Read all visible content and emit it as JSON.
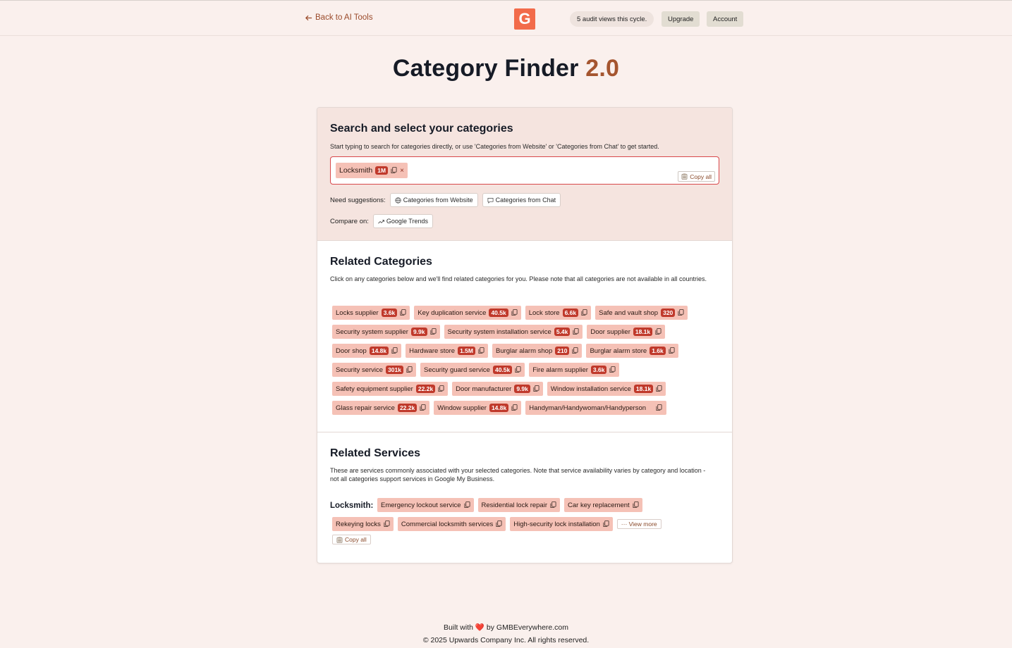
{
  "header": {
    "back_label": "Back to AI Tools",
    "logo_letter": "G",
    "audit_text": "5 audit views this cycle.",
    "upgrade_label": "Upgrade",
    "account_label": "Account"
  },
  "page": {
    "title_main": "Category Finder",
    "title_version": "2.0"
  },
  "search": {
    "heading": "Search and select your categories",
    "description": "Start typing to search for categories directly, or use 'Categories from Website' or 'Categories from Chat' to get started.",
    "selected": [
      {
        "label": "Locksmith",
        "count": "1M"
      }
    ],
    "copy_all_label": "Copy all",
    "suggestions_label": "Need suggestions:",
    "from_website_label": "Categories from Website",
    "from_chat_label": "Categories from Chat",
    "compare_label": "Compare on:",
    "google_trends_label": "Google Trends"
  },
  "related": {
    "heading": "Related Categories",
    "description": "Click on any categories below and we'll find related categories for you. Please note that all categories are not available in all countries.",
    "items": [
      {
        "label": "Locks supplier",
        "count": "3.6k"
      },
      {
        "label": "Key duplication service",
        "count": "40.5k"
      },
      {
        "label": "Lock store",
        "count": "6.6k"
      },
      {
        "label": "Safe and vault shop",
        "count": "320"
      },
      {
        "label": "Security system supplier",
        "count": "9.9k"
      },
      {
        "label": "Security system installation service",
        "count": "5.4k"
      },
      {
        "label": "Door supplier",
        "count": "18.1k"
      },
      {
        "label": "Door shop",
        "count": "14.8k"
      },
      {
        "label": "Hardware store",
        "count": "1.5M"
      },
      {
        "label": "Burglar alarm shop",
        "count": "210"
      },
      {
        "label": "Burglar alarm store",
        "count": "1.6k"
      },
      {
        "label": "Security service",
        "count": "301k"
      },
      {
        "label": "Security guard service",
        "count": "40.5k"
      },
      {
        "label": "Fire alarm supplier",
        "count": "3.6k"
      },
      {
        "label": "Safety equipment supplier",
        "count": "22.2k"
      },
      {
        "label": "Door manufacturer",
        "count": "9.9k"
      },
      {
        "label": "Window installation service",
        "count": "18.1k"
      },
      {
        "label": "Glass repair service",
        "count": "22.2k"
      },
      {
        "label": "Window supplier",
        "count": "14.8k"
      },
      {
        "label": "Handyman/Handywoman/Handyperson",
        "count": ""
      }
    ]
  },
  "services": {
    "heading": "Related Services",
    "description": "These are services commonly associated with your selected categories. Note that service availability varies by category and location - not all categories support services in Google My Business.",
    "category_label": "Locksmith:",
    "row1": [
      "Emergency lockout service",
      "Residential lock repair",
      "Car key replacement"
    ],
    "row2": [
      "Rekeying locks",
      "Commercial locksmith services",
      "High-security lock installation"
    ],
    "view_more_label": "··· View more",
    "copy_all_label": "Copy all"
  },
  "footer": {
    "built_prefix": "Built with",
    "built_heart": "❤️",
    "built_suffix": "by GMBEverywhere.com",
    "copyright": "© 2025 Upwards Company Inc. All rights reserved."
  }
}
